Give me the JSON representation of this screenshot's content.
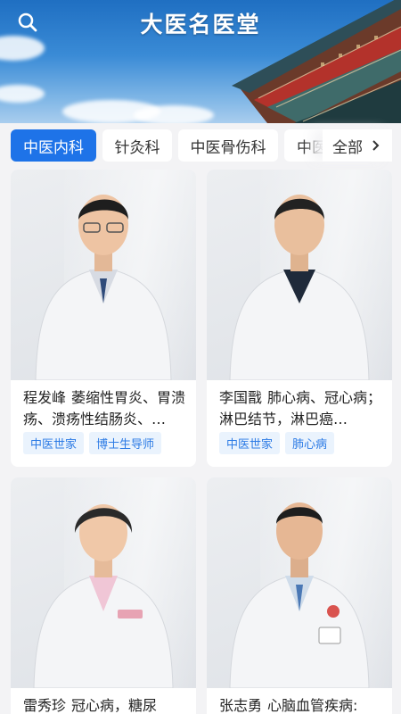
{
  "header": {
    "title": "大医名医堂",
    "icons": {
      "search": "search-icon"
    }
  },
  "categories": {
    "tabs": [
      {
        "label": "中医内科",
        "active": true
      },
      {
        "label": "针灸科",
        "active": false
      },
      {
        "label": "中医骨伤科",
        "active": false
      },
      {
        "label": "中医",
        "active": false
      }
    ],
    "all_label": "全部",
    "all_icon": "chevron-right-icon"
  },
  "doctors": [
    {
      "name": "程发峰",
      "specialty": "萎缩性胃炎、胃溃疡、溃疡性结肠炎、…",
      "tags": [
        "中医世家",
        "博士生导师"
      ]
    },
    {
      "name": "李国戬",
      "specialty": "肺心病、冠心病；淋巴结节，淋巴癌…",
      "tags": [
        "中医世家",
        "肺心病"
      ]
    },
    {
      "name": "雷秀珍",
      "specialty": "冠心病，糖尿",
      "tags": []
    },
    {
      "name": "张志勇",
      "specialty": "心脑血管疾病:",
      "tags": []
    }
  ],
  "colors": {
    "accent": "#1e73e8",
    "tag_bg": "#eaf3fd",
    "tag_text": "#2c7be5"
  }
}
